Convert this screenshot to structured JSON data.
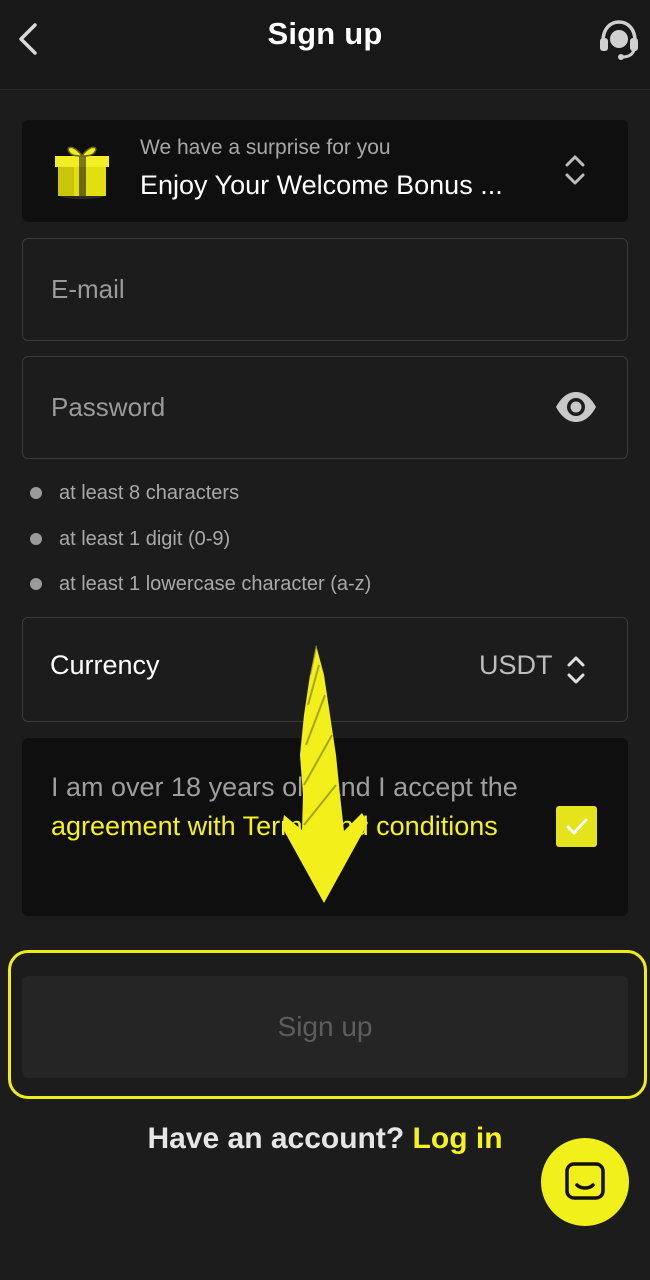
{
  "header": {
    "title": "Sign up"
  },
  "bonus": {
    "subtitle": "We have a surprise for you",
    "title": "Enjoy Your Welcome Bonus ..."
  },
  "form": {
    "email_placeholder": "E-mail",
    "email_value": "",
    "password_placeholder": "Password",
    "password_value": "",
    "rules": [
      "at least 8 characters",
      "at least 1 digit (0-9)",
      "at least 1 lowercase character (a-z)"
    ],
    "currency_label": "Currency",
    "currency_value": "USDT",
    "terms_prefix": "I am over 18 years old and I accept the ",
    "terms_link": "agreement with Terms and conditions",
    "terms_checked": true,
    "submit_label": "Sign up"
  },
  "footer": {
    "question": "Have an account?",
    "login_label": "Log in"
  },
  "colors": {
    "accent": "#f5f21c",
    "background": "#1c1c1c",
    "card": "#0f0f0f",
    "border": "#3b3b3b"
  },
  "icons": [
    "back-chevron-icon",
    "headset-support-icon",
    "gift-icon",
    "sort-chevrons-icon",
    "eye-icon",
    "check-icon",
    "chat-icon",
    "annotation-arrow-icon"
  ]
}
